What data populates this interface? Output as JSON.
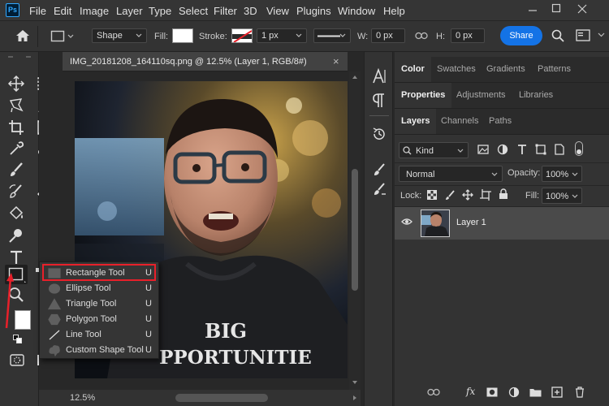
{
  "menubar": {
    "app_badge": "Ps",
    "items": [
      "File",
      "Edit",
      "Image",
      "Layer",
      "Type",
      "Select",
      "Filter",
      "3D",
      "View",
      "Plugins",
      "Window",
      "Help"
    ]
  },
  "options": {
    "shape_mode": "Shape",
    "fill_label": "Fill:",
    "stroke_label": "Stroke:",
    "stroke_width": "1 px",
    "w_label": "W:",
    "w_value": "0 px",
    "h_label": "H:",
    "h_value": "0 px",
    "share_label": "Share"
  },
  "document": {
    "tab_title": "IMG_20181208_164110sq.png @ 12.5% (Layer 1, RGB/8#)",
    "close_symbol": "×",
    "zoom": "12.5%",
    "shirt_line1": "BIG",
    "shirt_line2": "PPORTUNITIE"
  },
  "flyout": {
    "items": [
      {
        "label": "Rectangle Tool",
        "shortcut": "U",
        "icon": "rectangle-icon"
      },
      {
        "label": "Ellipse Tool",
        "shortcut": "U",
        "icon": "ellipse-icon"
      },
      {
        "label": "Triangle Tool",
        "shortcut": "U",
        "icon": "triangle-icon"
      },
      {
        "label": "Polygon Tool",
        "shortcut": "U",
        "icon": "polygon-icon"
      },
      {
        "label": "Line Tool",
        "shortcut": "U",
        "icon": "line-icon"
      },
      {
        "label": "Custom Shape Tool",
        "shortcut": "U",
        "icon": "custom-shape-icon"
      }
    ],
    "highlight_color": "#e8202a"
  },
  "panels": {
    "group1": [
      "Color",
      "Swatches",
      "Gradients",
      "Patterns"
    ],
    "group2": [
      "Properties",
      "Adjustments",
      "Libraries"
    ],
    "group3": [
      "Layers",
      "Channels",
      "Paths"
    ],
    "filter_kind": "Kind",
    "blend_mode": "Normal",
    "opacity_label": "Opacity:",
    "opacity_value": "100%",
    "lock_label": "Lock:",
    "fill_label": "Fill:",
    "fill_value": "100%",
    "layer_name": "Layer 1"
  },
  "colors": {
    "accent": "#1473e6",
    "annotation": "#e8202a"
  }
}
